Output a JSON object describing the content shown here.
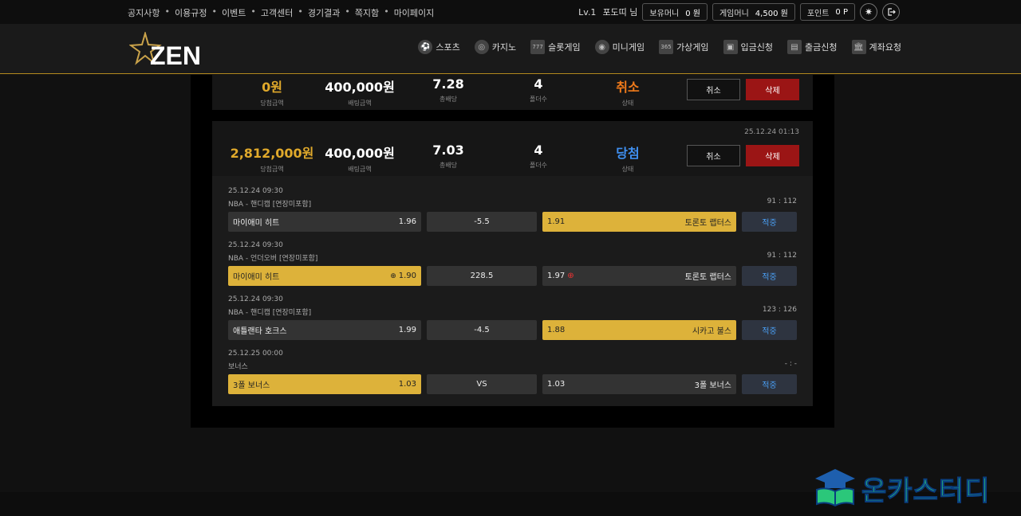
{
  "topbar": {
    "links": [
      "공지사항",
      "이용규정",
      "이벤트",
      "고객센터",
      "경기결과",
      "쪽지함",
      "마이페이지"
    ],
    "user_level": "Lv.1",
    "user_name": "포도띠 님",
    "holding_money_label": "보유머니",
    "holding_money_value": "0 원",
    "game_money_label": "게임머니",
    "game_money_value": "4,500 원",
    "points_label": "포인트",
    "points_value": "0 P"
  },
  "logo": {
    "text": "ZEN"
  },
  "nav": [
    {
      "label": "스포츠",
      "icon": "soccer-ball-icon"
    },
    {
      "label": "카지노",
      "icon": "casino-chip-icon"
    },
    {
      "label": "슬롯게임",
      "icon": "slot-777-icon"
    },
    {
      "label": "미니게임",
      "icon": "mini-game-icon"
    },
    {
      "label": "가상게임",
      "icon": "bet365-icon"
    },
    {
      "label": "입금신청",
      "icon": "deposit-icon"
    },
    {
      "label": "출금신청",
      "icon": "withdraw-icon"
    },
    {
      "label": "계좌요청",
      "icon": "bank-icon"
    }
  ],
  "card1": {
    "win_amount": "0원",
    "win_label": "당첨금액",
    "bet_amount": "400,000원",
    "bet_label": "배팅금액",
    "total_odds": "7.28",
    "odds_label": "총배당",
    "folders": "4",
    "folders_label": "폴더수",
    "status": "취소",
    "status_label": "상태",
    "cancel_btn": "취소",
    "delete_btn": "삭제"
  },
  "card2": {
    "date": "25.12.24 01:13",
    "win_amount": "2,812,000원",
    "win_label": "당첨금액",
    "bet_amount": "400,000원",
    "bet_label": "배팅금액",
    "total_odds": "7.03",
    "odds_label": "총배당",
    "folders": "4",
    "folders_label": "폴더수",
    "status": "당첨",
    "status_label": "상태",
    "cancel_btn": "취소",
    "delete_btn": "삭제",
    "bets": [
      {
        "date": "25.12.24 09:30",
        "league": "NBA - 핸디캡 [연장미포함]",
        "score": "91 : 112",
        "home": "마이애미 히트",
        "home_odds": "1.96",
        "mid": "-5.5",
        "away": "토론토 랩터스",
        "away_odds": "1.91",
        "result": "적중",
        "selected": "away"
      },
      {
        "date": "25.12.24 09:30",
        "league": "NBA - 언더오버 [연장미포함]",
        "score": "91 : 112",
        "home": "마이애미 히트",
        "home_odds": "1.90",
        "mid": "228.5",
        "away": "토론토 랩터스",
        "away_odds": "1.97",
        "result": "적중",
        "selected": "home"
      },
      {
        "date": "25.12.24 09:30",
        "league": "NBA - 핸디캡 [연장미포함]",
        "score": "123 : 126",
        "home": "애틀랜타 호크스",
        "home_odds": "1.99",
        "mid": "-4.5",
        "away": "시카고 불스",
        "away_odds": "1.88",
        "result": "적중",
        "selected": "away"
      },
      {
        "date": "25.12.25 00:00",
        "league": "보너스",
        "score": "- : -",
        "home": "3폴 보너스",
        "home_odds": "1.03",
        "mid": "VS",
        "away": "3폴 보너스",
        "away_odds": "1.03",
        "result": "적중",
        "selected": "home"
      }
    ]
  },
  "watermark": {
    "text": "온카스터디"
  },
  "colors": {
    "gold": "#ddb23a",
    "accent_border": "#b58a1e",
    "delete_red": "#9b1515",
    "win_blue": "#3f8ff0",
    "cancel_orange": "#f07a1a"
  }
}
